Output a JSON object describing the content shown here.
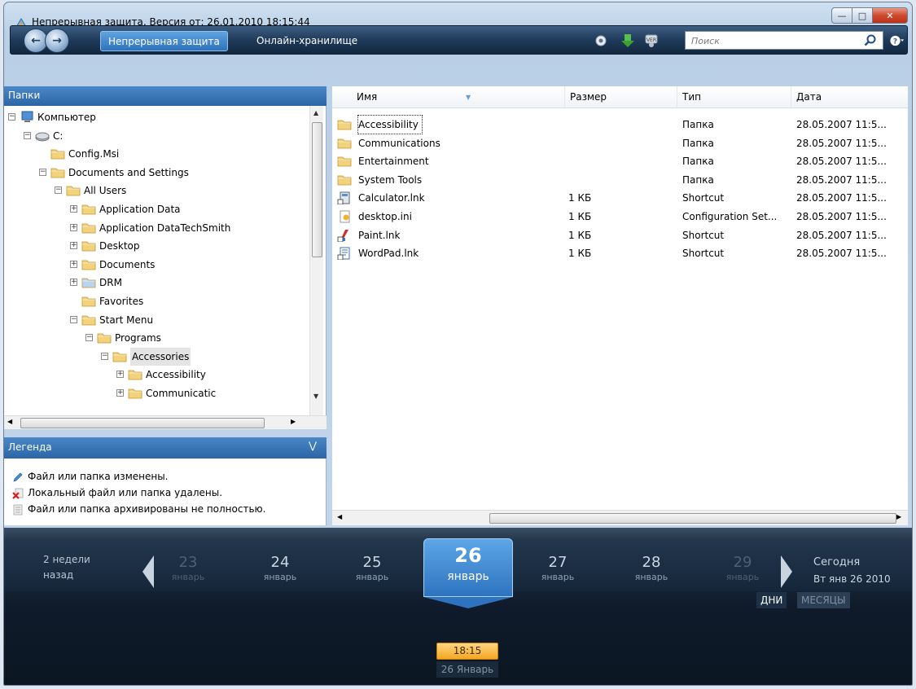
{
  "window": {
    "title": "Непрерывная защита, Версия от: 26.01.2010 18:15:44",
    "buttons": [
      "minimize",
      "maximize",
      "close"
    ]
  },
  "toolbar": {
    "tabs": [
      {
        "label": "Непрерывная защита",
        "active": true
      },
      {
        "label": "Онлайн-хранилище",
        "active": false
      }
    ],
    "icons": [
      "settings-gear-icon",
      "download-icon",
      "version-icon"
    ],
    "search_placeholder": "Поиск"
  },
  "folders": {
    "header": "Папки",
    "tree": [
      {
        "label": "Компьютер",
        "icon": "computer",
        "expander": "-"
      },
      {
        "label": "C:",
        "icon": "drive",
        "expander": "-"
      },
      {
        "label": "Config.Msi",
        "icon": "folder",
        "expander": ""
      },
      {
        "label": "Documents and Settings",
        "icon": "folder",
        "expander": "-"
      },
      {
        "label": "All Users",
        "icon": "folder",
        "expander": "-"
      },
      {
        "label": "Application Data",
        "icon": "folder",
        "expander": "+"
      },
      {
        "label": "Application DataTechSmith",
        "icon": "folder",
        "expander": "+"
      },
      {
        "label": "Desktop",
        "icon": "folder",
        "expander": "+"
      },
      {
        "label": "Documents",
        "icon": "folder",
        "expander": "+"
      },
      {
        "label": "DRM",
        "icon": "folder-special",
        "expander": "+"
      },
      {
        "label": "Favorites",
        "icon": "folder",
        "expander": ""
      },
      {
        "label": "Start Menu",
        "icon": "folder",
        "expander": "-"
      },
      {
        "label": "Programs",
        "icon": "folder",
        "expander": "-"
      },
      {
        "label": "Accessories",
        "icon": "folder",
        "expander": "-",
        "selected": true
      },
      {
        "label": "Accessibility",
        "icon": "folder",
        "expander": "+"
      },
      {
        "label": "Communicatic",
        "icon": "folder",
        "expander": "+"
      }
    ]
  },
  "legend": {
    "header": "Легенда",
    "items": [
      {
        "label": "Файл или папка изменены.",
        "icon": "pencil-icon"
      },
      {
        "label": "Локальный файл или папка удалены.",
        "icon": "deleted-x-icon"
      },
      {
        "label": "Файл или папка архивированы не полностью.",
        "icon": "partial-archive-icon"
      }
    ]
  },
  "files": {
    "columns": [
      "Имя",
      "Размер",
      "Тип",
      "Дата"
    ],
    "rows": [
      {
        "name": "Accessibility",
        "size": "",
        "type": "Папка",
        "date": "28.05.2007 11:5...",
        "icon": "folder"
      },
      {
        "name": "Communications",
        "size": "",
        "type": "Папка",
        "date": "28.05.2007 11:5...",
        "icon": "folder"
      },
      {
        "name": "Entertainment",
        "size": "",
        "type": "Папка",
        "date": "28.05.2007 11:5...",
        "icon": "folder"
      },
      {
        "name": "System Tools",
        "size": "",
        "type": "Папка",
        "date": "28.05.2007 11:5...",
        "icon": "folder"
      },
      {
        "name": "Calculator.lnk",
        "size": "1 КБ",
        "type": "Shortcut",
        "date": "28.05.2007 11:5...",
        "icon": "calculator-shortcut"
      },
      {
        "name": "desktop.ini",
        "size": "1 КБ",
        "type": "Configuration Set...",
        "date": "28.05.2007 11:5...",
        "icon": "ini-file"
      },
      {
        "name": "Paint.lnk",
        "size": "1 КБ",
        "type": "Shortcut",
        "date": "28.05.2007 11:5...",
        "icon": "paint-shortcut"
      },
      {
        "name": "WordPad.lnk",
        "size": "1 КБ",
        "type": "Shortcut",
        "date": "28.05.2007 11:5...",
        "icon": "wordpad-shortcut"
      }
    ]
  },
  "timeline": {
    "back_line1": "2 недели",
    "back_line2": "назад",
    "days": [
      {
        "num": "23",
        "month": "январь",
        "dim": true
      },
      {
        "num": "24",
        "month": "январь",
        "dim": false
      },
      {
        "num": "25",
        "month": "январь",
        "dim": false
      },
      {
        "num": "26",
        "month": "январь",
        "selected": true
      },
      {
        "num": "27",
        "month": "январь",
        "dim": false
      },
      {
        "num": "28",
        "month": "январь",
        "dim": false
      },
      {
        "num": "29",
        "month": "январь",
        "dim": true
      }
    ],
    "today_label": "Сегодня",
    "today_date": "Вт янв 26 2010",
    "mode_days": "ДНИ",
    "mode_months": "МЕСЯЦЫ",
    "marker_time": "18:15",
    "marker_date": "26 Январь"
  },
  "colors": {
    "accent": "#2e73bf",
    "marker": "#f5a623"
  }
}
